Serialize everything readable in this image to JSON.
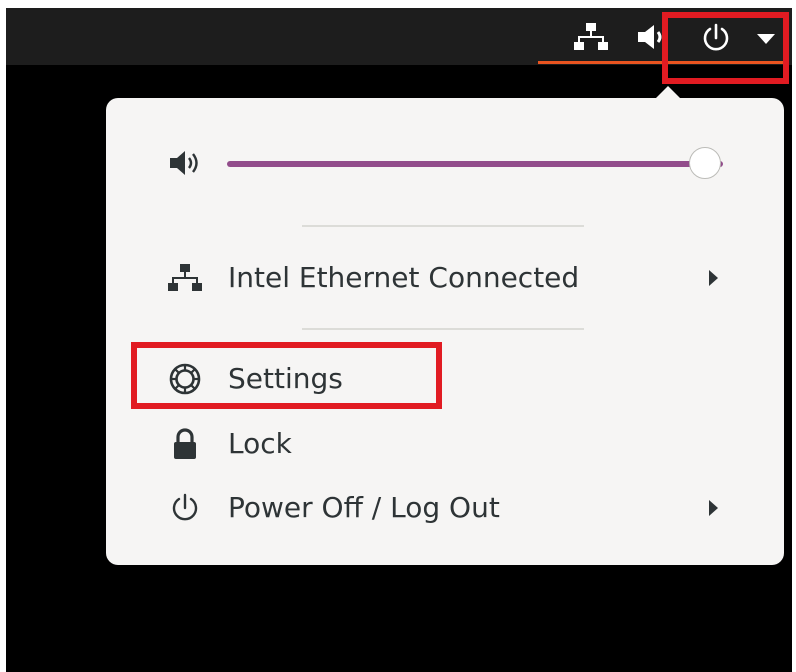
{
  "topbar": {
    "icons": [
      "network-wired-icon",
      "speaker-volume-icon",
      "power-icon",
      "dropdown-arrow-icon"
    ],
    "accent_color": "#e95420"
  },
  "system_menu": {
    "volume": {
      "icon": "speaker-volume-icon",
      "level_percent": 100,
      "slider_color": "#924d8b"
    },
    "network": {
      "icon": "network-wired-icon",
      "label": "Intel Ethernet Connected",
      "has_submenu": true
    },
    "settings": {
      "icon": "gear-icon",
      "label": "Settings"
    },
    "lock": {
      "icon": "lock-icon",
      "label": "Lock"
    },
    "power": {
      "icon": "power-icon",
      "label": "Power Off / Log Out",
      "has_submenu": true
    }
  },
  "annotation_color": "#e11b22"
}
